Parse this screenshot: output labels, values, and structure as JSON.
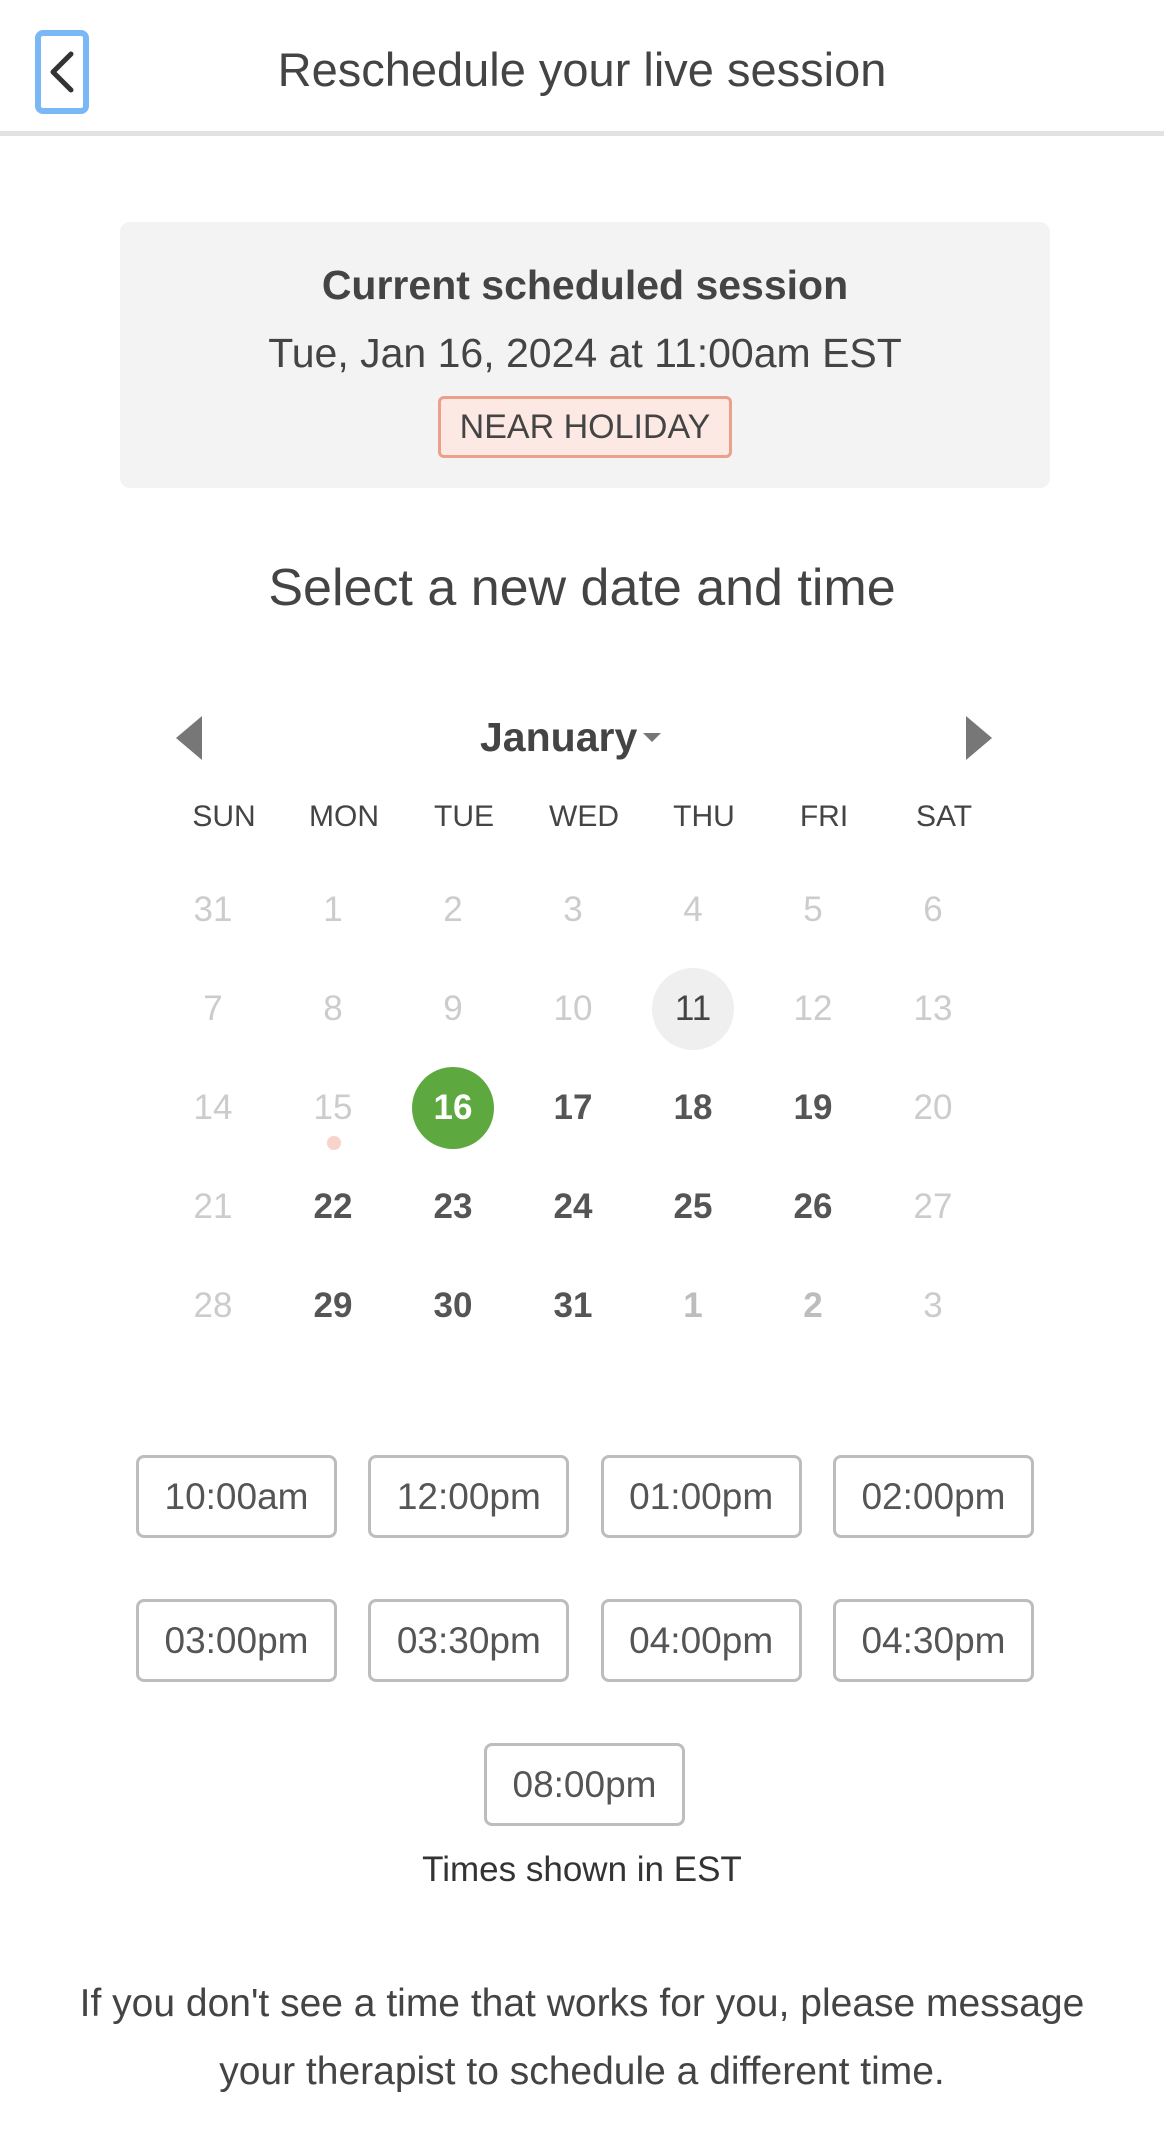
{
  "header": {
    "title": "Reschedule your live session",
    "back_icon": "chevron-left-icon"
  },
  "current_session": {
    "label": "Current scheduled session",
    "datetime": "Tue, Jan 16, 2024 at 11:00am EST",
    "badge": "NEAR HOLIDAY"
  },
  "select_heading": "Select a new date and time",
  "calendar": {
    "month": "January",
    "weekdays": [
      "SUN",
      "MON",
      "TUE",
      "WED",
      "THU",
      "FRI",
      "SAT"
    ],
    "weeks": [
      [
        {
          "d": "31",
          "s": "muted"
        },
        {
          "d": "1",
          "s": "muted"
        },
        {
          "d": "2",
          "s": "muted"
        },
        {
          "d": "3",
          "s": "muted"
        },
        {
          "d": "4",
          "s": "muted"
        },
        {
          "d": "5",
          "s": "muted"
        },
        {
          "d": "6",
          "s": "muted"
        }
      ],
      [
        {
          "d": "7",
          "s": "muted"
        },
        {
          "d": "8",
          "s": "muted"
        },
        {
          "d": "9",
          "s": "muted"
        },
        {
          "d": "10",
          "s": "muted"
        },
        {
          "d": "11",
          "s": "today"
        },
        {
          "d": "12",
          "s": "muted"
        },
        {
          "d": "13",
          "s": "muted"
        }
      ],
      [
        {
          "d": "14",
          "s": "muted"
        },
        {
          "d": "15",
          "s": "holiday"
        },
        {
          "d": "16",
          "s": "selected"
        },
        {
          "d": "17",
          "s": "avail"
        },
        {
          "d": "18",
          "s": "avail"
        },
        {
          "d": "19",
          "s": "avail"
        },
        {
          "d": "20",
          "s": "muted"
        }
      ],
      [
        {
          "d": "21",
          "s": "muted"
        },
        {
          "d": "22",
          "s": "avail"
        },
        {
          "d": "23",
          "s": "avail"
        },
        {
          "d": "24",
          "s": "avail"
        },
        {
          "d": "25",
          "s": "avail"
        },
        {
          "d": "26",
          "s": "avail"
        },
        {
          "d": "27",
          "s": "muted"
        }
      ],
      [
        {
          "d": "28",
          "s": "muted"
        },
        {
          "d": "29",
          "s": "avail"
        },
        {
          "d": "30",
          "s": "avail"
        },
        {
          "d": "31",
          "s": "avail"
        },
        {
          "d": "1",
          "s": "muted-bold"
        },
        {
          "d": "2",
          "s": "muted-bold"
        },
        {
          "d": "3",
          "s": "muted"
        }
      ]
    ]
  },
  "time_slots": {
    "row1": [
      "10:00am",
      "12:00pm",
      "01:00pm",
      "02:00pm"
    ],
    "row2": [
      "03:00pm",
      "03:30pm",
      "04:00pm",
      "04:30pm"
    ],
    "row3": [
      "08:00pm"
    ]
  },
  "timezone_note": "Times shown in EST",
  "footer_message": "If you don't see a time that works for you, please message your therapist to schedule a different time.",
  "colors": {
    "selected_day": "#5da83f",
    "badge_border": "#ec9f8d",
    "badge_bg": "#fde9e4",
    "back_focus": "#7ab8f5"
  }
}
